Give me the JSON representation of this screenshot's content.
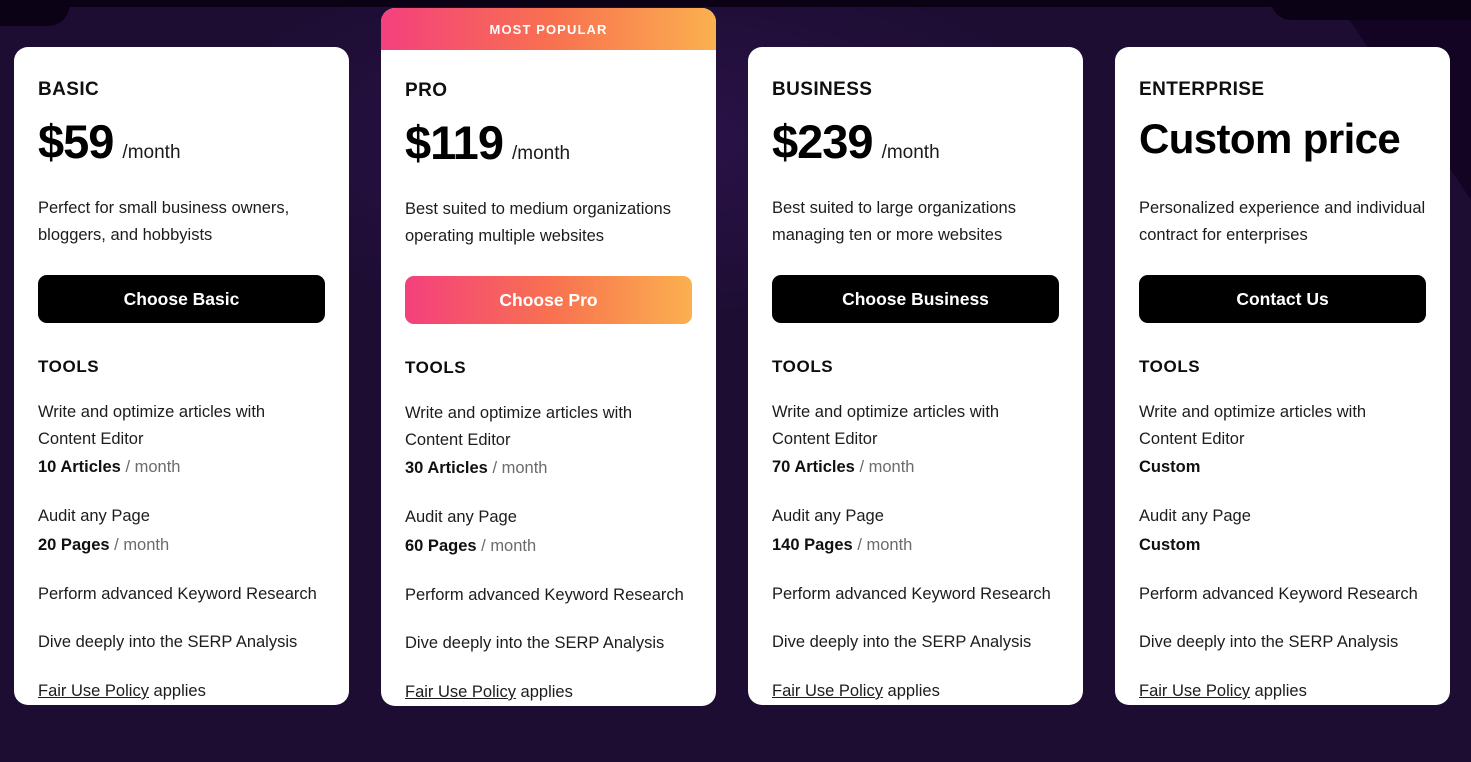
{
  "theme": {
    "page_background": "#1d0d33",
    "card_background": "#ffffff",
    "accent_gradient_start": "#f4407d",
    "accent_gradient_mid": "#f8724f",
    "accent_gradient_end": "#fbb04f",
    "dark_button": "#000000"
  },
  "section": {
    "features_heading": "TOOLS",
    "policy_link_label": "Fair Use Policy",
    "policy_suffix": " applies"
  },
  "plans": [
    {
      "name": "BASIC",
      "price": "$59",
      "period": "/month",
      "description": "Perfect for small business owners, bloggers, and hobbyists",
      "cta_label": "Choose Basic",
      "cta_style": "dark",
      "badge": null,
      "features": [
        {
          "text": "Write and optimize articles with Content Editor",
          "quota_qty": "10 Articles",
          "quota_unit": " / month"
        },
        {
          "text": "Audit any Page",
          "quota_qty": "20 Pages",
          "quota_unit": " / month"
        },
        {
          "text": "Perform advanced Keyword Research",
          "quota_qty": "",
          "quota_unit": ""
        },
        {
          "text": "Dive deeply into the SERP Analysis",
          "quota_qty": "",
          "quota_unit": ""
        }
      ]
    },
    {
      "name": "PRO",
      "price": "$119",
      "period": "/month",
      "description": "Best suited to medium organizations operating multiple websites",
      "cta_label": "Choose Pro",
      "cta_style": "gradient",
      "badge": "MOST POPULAR",
      "features": [
        {
          "text": "Write and optimize articles with Content Editor",
          "quota_qty": "30 Articles",
          "quota_unit": " / month"
        },
        {
          "text": "Audit any Page",
          "quota_qty": "60 Pages",
          "quota_unit": " / month"
        },
        {
          "text": "Perform advanced Keyword Research",
          "quota_qty": "",
          "quota_unit": ""
        },
        {
          "text": "Dive deeply into the SERP Analysis",
          "quota_qty": "",
          "quota_unit": ""
        }
      ]
    },
    {
      "name": "BUSINESS",
      "price": "$239",
      "period": "/month",
      "description": "Best suited to large organizations managing ten or more websites",
      "cta_label": "Choose Business",
      "cta_style": "dark",
      "badge": null,
      "features": [
        {
          "text": "Write and optimize articles with Content Editor",
          "quota_qty": "70 Articles",
          "quota_unit": " / month"
        },
        {
          "text": "Audit any Page",
          "quota_qty": "140 Pages",
          "quota_unit": " / month"
        },
        {
          "text": "Perform advanced Keyword Research",
          "quota_qty": "",
          "quota_unit": ""
        },
        {
          "text": "Dive deeply into the SERP Analysis",
          "quota_qty": "",
          "quota_unit": ""
        }
      ]
    },
    {
      "name": "ENTERPRISE",
      "price": "Custom price",
      "period": "",
      "description": "Personalized experience and individual contract for enterprises",
      "cta_label": "Contact Us",
      "cta_style": "dark",
      "badge": null,
      "features": [
        {
          "text": "Write and optimize articles with Content Editor",
          "quota_qty": "Custom",
          "quota_unit": ""
        },
        {
          "text": "Audit any Page",
          "quota_qty": "Custom",
          "quota_unit": ""
        },
        {
          "text": "Perform advanced Keyword Research",
          "quota_qty": "",
          "quota_unit": ""
        },
        {
          "text": "Dive deeply into the SERP Analysis",
          "quota_qty": "",
          "quota_unit": ""
        }
      ]
    }
  ]
}
